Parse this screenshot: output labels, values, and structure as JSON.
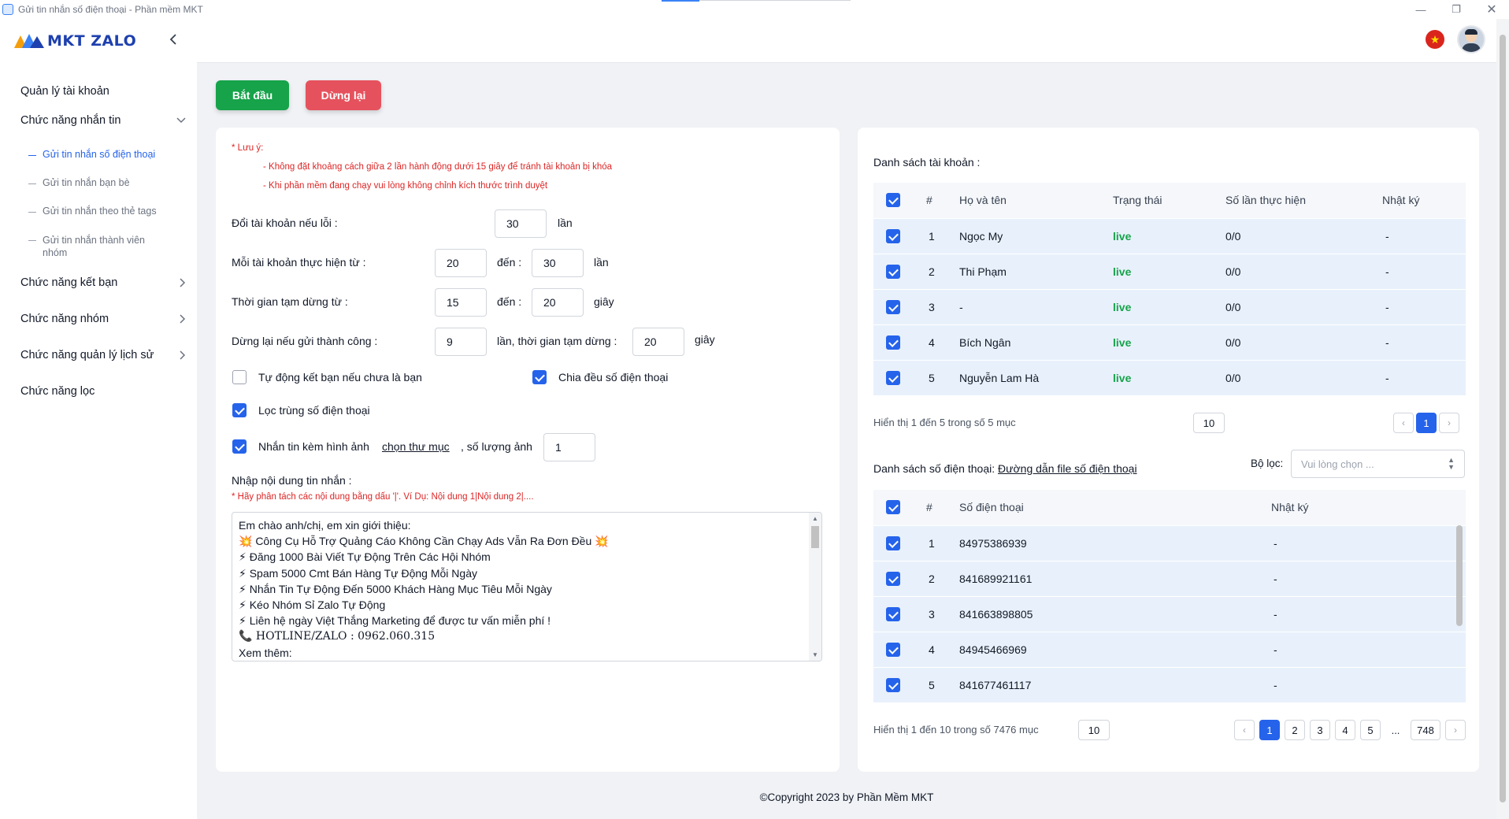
{
  "window": {
    "title": "Gửi tin nhắn số điện thoại - Phần mềm MKT",
    "min_icon": "minimize-icon",
    "max_icon": "restore-icon",
    "close_icon": "close-icon"
  },
  "brand": {
    "name": "MKT ZALO",
    "primary_color": "#1e40af",
    "accent_color": "#f59e0b"
  },
  "sidebar": {
    "items": [
      {
        "label": "Quản lý tài khoản"
      },
      {
        "label": "Chức năng nhắn tin",
        "expanded": true,
        "children": [
          {
            "label": "Gửi tin nhắn số điện thoại",
            "active": true
          },
          {
            "label": "Gửi tin nhắn bạn bè"
          },
          {
            "label": "Gửi tin nhắn theo thẻ tags"
          },
          {
            "label": "Gửi tin nhắn thành viên nhóm"
          }
        ]
      },
      {
        "label": "Chức năng kết bạn"
      },
      {
        "label": "Chức năng nhóm"
      },
      {
        "label": "Chức năng quản lý lịch sử"
      },
      {
        "label": "Chức năng lọc"
      }
    ]
  },
  "header": {
    "language_flag_icon": "vietnam-flag-icon",
    "avatar_icon": "user-avatar-icon"
  },
  "actions": {
    "start_label": "Bắt đầu",
    "stop_label": "Dừng lại",
    "start_color": "#16a34a",
    "stop_color": "#e5525d"
  },
  "settings": {
    "note_title": "* Lưu ý:",
    "notes": [
      "- Không đặt khoảng cách giữa 2 lần hành động dưới 15 giây để tránh tài khoản bị khóa",
      "- Khi phần mềm đang chạy vui lòng không chỉnh kích thước trình duyệt"
    ],
    "switch_account_label": "Đổi tài khoản nếu lỗi :",
    "switch_account_value": "30",
    "switch_account_unit": "lần",
    "per_account_label": "Mỗi tài khoản thực hiện từ :",
    "per_account_from": "20",
    "per_account_to_label": "đến :",
    "per_account_to": "30",
    "per_account_unit": "lần",
    "pause_label": "Thời gian tạm dừng từ :",
    "pause_from": "15",
    "pause_to_label": "đến :",
    "pause_to": "20",
    "pause_unit": "giây",
    "stop_after_label": "Dừng lại nếu gửi thành công :",
    "stop_after_value": "9",
    "stop_after_mid": "lần, thời gian tạm dừng :",
    "stop_after_pause": "20",
    "stop_after_unit": "giây",
    "auto_friend_label": "Tự động kết bạn nếu chưa là bạn",
    "auto_friend_checked": false,
    "split_phone_label": "Chia đều số điện thoại",
    "split_phone_checked": true,
    "filter_dup_label": "Lọc trùng số điện thoại",
    "filter_dup_checked": true,
    "attach_image_label": "Nhắn tin kèm hình ảnh",
    "attach_image_checked": true,
    "choose_folder_label": "chọn thư mục",
    "image_count_label": ", số lượng ảnh",
    "image_count_value": "1",
    "message_label": "Nhập nội dung tin nhắn :",
    "message_hint": "* Hãy phân tách các nội dung bằng dấu '|'. Ví Dụ: Nội dung 1|Nội dung 2|....",
    "message_lines": [
      "Em chào anh/chị, em xin giới thiệu:",
      "💥 Công Cụ Hỗ Trợ Quảng Cáo Không Cần Chạy Ads Vẫn Ra Đơn Đều 💥",
      "⚡ Đăng 1000 Bài Viết Tự Động Trên Các Hội Nhóm",
      "⚡ Spam 5000 Cmt Bán Hàng Tự Động Mỗi Ngày",
      "⚡ Nhắn Tin Tự Động Đến 5000 Khách Hàng Mục Tiêu Mỗi Ngày",
      "⚡ Kéo Nhóm Sỉ Zalo Tự Động",
      "⚡ Liên hệ ngày Việt Thắng Marketing để được tư vấn miễn phí !",
      "📞 HOTLINE/ZALO : 0962.060.315",
      "Xem thêm:"
    ]
  },
  "accounts": {
    "title": "Danh sách tài khoản :",
    "columns": [
      "#",
      "Họ và tên",
      "Trạng thái",
      "Số lần thực hiện",
      "Nhật ký"
    ],
    "rows": [
      {
        "no": "1",
        "name": "Ngọc My",
        "status": "live",
        "count": "0/0",
        "log": "-"
      },
      {
        "no": "2",
        "name": "Thi Phạm",
        "status": "live",
        "count": "0/0",
        "log": "-"
      },
      {
        "no": "3",
        "name": "-",
        "status": "live",
        "count": "0/0",
        "log": "-"
      },
      {
        "no": "4",
        "name": "Bích Ngân",
        "status": "live",
        "count": "0/0",
        "log": "-"
      },
      {
        "no": "5",
        "name": "Nguyễn Lam Hà",
        "status": "live",
        "count": "0/0",
        "log": "-"
      }
    ],
    "info": "Hiển thị 1 đến 5 trong số 5 mục",
    "page_size": "10",
    "pages": [
      "1"
    ],
    "current_page": "1",
    "status_color": "#16a34a"
  },
  "phones": {
    "title": "Danh sách số điện thoại:",
    "file_link": "Đường dẫn file số điện thoại",
    "filter_label": "Bộ lọc:",
    "filter_placeholder": "Vui lòng chọn ...",
    "columns": [
      "#",
      "Số điện thoại",
      "Nhật ký"
    ],
    "rows": [
      {
        "no": "1",
        "phone": "84975386939",
        "log": "-"
      },
      {
        "no": "2",
        "phone": "841689921161",
        "log": "-"
      },
      {
        "no": "3",
        "phone": "841663898805",
        "log": "-"
      },
      {
        "no": "4",
        "phone": "84945466969",
        "log": "-"
      },
      {
        "no": "5",
        "phone": "841677461117",
        "log": "-"
      }
    ],
    "info": "Hiển thị 1 đến 10 trong số 7476 mục",
    "page_size": "10",
    "pages": [
      "1",
      "2",
      "3",
      "4",
      "5"
    ],
    "ellipsis": "...",
    "last_page": "748",
    "current_page": "1"
  },
  "footer": {
    "copyright": "©Copyright 2023 by Phần Mềm MKT"
  }
}
